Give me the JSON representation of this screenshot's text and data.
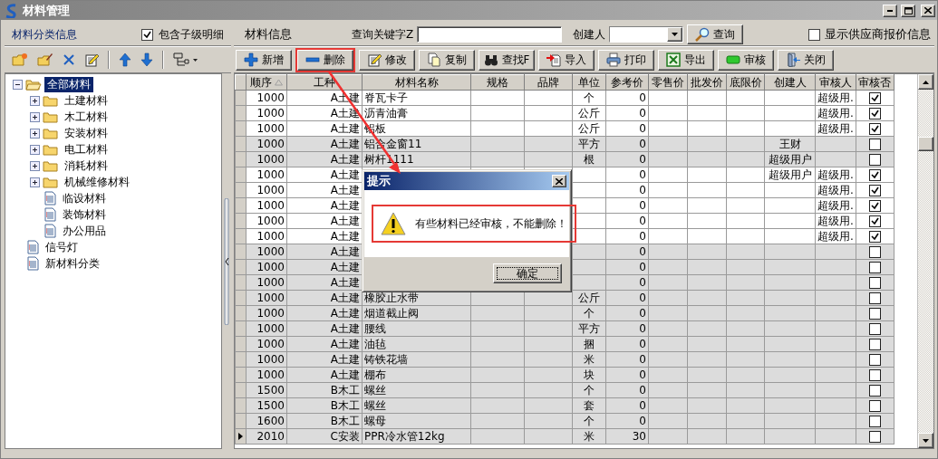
{
  "window": {
    "title": "材料管理"
  },
  "category_panel": {
    "title": "材料分类信息",
    "include_children": {
      "label": "包含子级明细",
      "checked": true
    },
    "tree": [
      {
        "label": "全部材料",
        "kind": "folder",
        "expanded": true,
        "selected": true,
        "children": [
          {
            "label": "土建材料",
            "kind": "folder",
            "expanded": false,
            "selected": false
          },
          {
            "label": "木工材料",
            "kind": "folder",
            "expanded": false,
            "selected": false
          },
          {
            "label": "安装材料",
            "kind": "folder",
            "expanded": false,
            "selected": false
          },
          {
            "label": "电工材料",
            "kind": "folder",
            "expanded": false,
            "selected": false
          },
          {
            "label": "消耗材料",
            "kind": "folder",
            "expanded": false,
            "selected": false
          },
          {
            "label": "机械维修材料",
            "kind": "folder",
            "expanded": false,
            "selected": false
          },
          {
            "label": "临设材料",
            "kind": "document",
            "selected": false
          },
          {
            "label": "装饰材料",
            "kind": "document",
            "selected": false
          },
          {
            "label": "办公用品",
            "kind": "document",
            "selected": false
          }
        ]
      },
      {
        "label": "信号灯",
        "kind": "document",
        "selected": false
      },
      {
        "label": "新材料分类",
        "kind": "document",
        "selected": false
      }
    ]
  },
  "material_panel": {
    "title": "材料信息",
    "keyword_label": "查询关键字Z",
    "creator_label": "创建人",
    "search_button": "查询",
    "show_supplier_prices": {
      "label": "显示供应商报价信息",
      "checked": false
    },
    "toolbar": [
      {
        "label": "新增",
        "highlighted": false
      },
      {
        "label": "删除",
        "highlighted": true
      },
      {
        "label": "修改",
        "highlighted": false
      },
      {
        "label": "复制",
        "highlighted": false
      },
      {
        "label": "查找F",
        "highlighted": false
      },
      {
        "label": "导入",
        "highlighted": false
      },
      {
        "label": "打印",
        "highlighted": false
      },
      {
        "label": "导出",
        "highlighted": false
      },
      {
        "label": "审核",
        "highlighted": false
      },
      {
        "label": "关闭",
        "highlighted": false
      }
    ],
    "table": {
      "columns": [
        {
          "label": "顺序",
          "sorted": true
        },
        {
          "label": "工种",
          "sorted": false
        },
        {
          "label": "材料名称",
          "sorted": false
        },
        {
          "label": "规格",
          "sorted": false
        },
        {
          "label": "品牌",
          "sorted": false
        },
        {
          "label": "单位",
          "sorted": false
        },
        {
          "label": "参考价",
          "sorted": false
        },
        {
          "label": "零售价",
          "sorted": false
        },
        {
          "label": "批发价",
          "sorted": false
        },
        {
          "label": "底限价",
          "sorted": false
        },
        {
          "label": "创建人",
          "sorted": false
        },
        {
          "label": "审核人",
          "sorted": false
        },
        {
          "label": "审核否",
          "sorted": false
        }
      ],
      "rows": [
        {
          "order": "1000",
          "work_type": "A土建",
          "name": "脊瓦卡子",
          "unit": "个",
          "ref_price": "0",
          "auditor": "超级用.",
          "audited": true,
          "current": false
        },
        {
          "order": "1000",
          "work_type": "A土建",
          "name": "沥青油膏",
          "unit": "公斤",
          "ref_price": "0",
          "auditor": "超级用.",
          "audited": true,
          "current": false
        },
        {
          "order": "1000",
          "work_type": "A土建",
          "name": "铝板",
          "unit": "公斤",
          "ref_price": "0",
          "auditor": "超级用.",
          "audited": true,
          "current": false
        },
        {
          "order": "1000",
          "work_type": "A土建",
          "name": "铝合金窗11",
          "unit": "平方",
          "ref_price": "0",
          "creator": "王财",
          "audited": false,
          "current": false
        },
        {
          "order": "1000",
          "work_type": "A土建",
          "name": "树杆1111",
          "unit": "根",
          "ref_price": "0",
          "creator": "超级用户",
          "audited": false,
          "current": false
        },
        {
          "order": "1000",
          "work_type": "A土建",
          "ref_price": "0",
          "creator": "超级用户",
          "auditor": "超级用.",
          "audited": true,
          "current": false
        },
        {
          "order": "1000",
          "work_type": "A土建",
          "ref_price": "0",
          "auditor": "超级用.",
          "audited": true,
          "current": false
        },
        {
          "order": "1000",
          "work_type": "A土建",
          "ref_price": "0",
          "auditor": "超级用.",
          "audited": true,
          "current": false
        },
        {
          "order": "1000",
          "work_type": "A土建",
          "ref_price": "0",
          "auditor": "超级用.",
          "audited": true,
          "current": false
        },
        {
          "order": "1000",
          "work_type": "A土建",
          "ref_price": "0",
          "auditor": "超级用.",
          "audited": true,
          "current": false
        },
        {
          "order": "1000",
          "work_type": "A土建",
          "ref_price": "0",
          "audited": false,
          "current": false
        },
        {
          "order": "1000",
          "work_type": "A土建",
          "ref_price": "0",
          "audited": false,
          "current": false
        },
        {
          "order": "1000",
          "work_type": "A土建",
          "ref_price": "0",
          "audited": false,
          "current": false
        },
        {
          "order": "1000",
          "work_type": "A土建",
          "name": "橡胶止水带",
          "unit": "公斤",
          "ref_price": "0",
          "audited": false,
          "current": false
        },
        {
          "order": "1000",
          "work_type": "A土建",
          "name": "烟道截止阀",
          "unit": "个",
          "ref_price": "0",
          "audited": false,
          "current": false
        },
        {
          "order": "1000",
          "work_type": "A土建",
          "name": "腰线",
          "unit": "平方",
          "ref_price": "0",
          "audited": false,
          "current": false
        },
        {
          "order": "1000",
          "work_type": "A土建",
          "name": "油毡",
          "unit": "捆",
          "ref_price": "0",
          "audited": false,
          "current": false
        },
        {
          "order": "1000",
          "work_type": "A土建",
          "name": "铸铁花墙",
          "unit": "米",
          "ref_price": "0",
          "audited": false,
          "current": false
        },
        {
          "order": "1000",
          "work_type": "A土建",
          "name": "棚布",
          "unit": "块",
          "ref_price": "0",
          "audited": false,
          "current": false
        },
        {
          "order": "1500",
          "work_type": "B木工",
          "name": "螺丝",
          "unit": "个",
          "ref_price": "0",
          "audited": false,
          "current": false
        },
        {
          "order": "1500",
          "work_type": "B木工",
          "name": "螺丝",
          "unit": "套",
          "ref_price": "0",
          "audited": false,
          "current": false
        },
        {
          "order": "1600",
          "work_type": "B木工",
          "name": "螺母",
          "unit": "个",
          "ref_price": "0",
          "audited": false,
          "current": false
        },
        {
          "order": "2010",
          "work_type": "C安装",
          "name": "PPR冷水管12kg",
          "unit": "米",
          "ref_price": "30",
          "audited": false,
          "current": true
        }
      ]
    }
  },
  "dialog": {
    "title": "提示",
    "message": "有些材料已经审核，不能删除！",
    "message_highlighted": true,
    "buttons": [
      {
        "label": "确定",
        "focused": true
      }
    ]
  },
  "annotations": [
    {
      "kind": "arrow"
    }
  ]
}
